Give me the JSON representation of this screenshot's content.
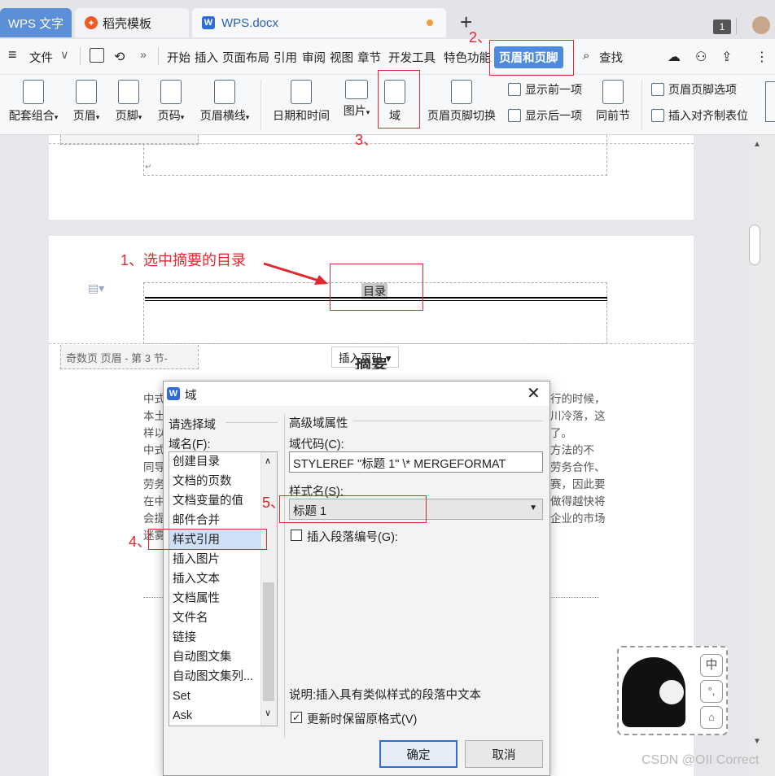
{
  "tabs": {
    "wps": "WPS 文字",
    "daoke": "稻壳模板",
    "doc": "WPS.docx",
    "plus": "+",
    "badge": "1"
  },
  "menu": {
    "file": "文件",
    "more": "»",
    "items": [
      "开始",
      "插入",
      "页面布局",
      "引用",
      "审阅",
      "视图",
      "章节",
      "开发工具",
      "特色功能"
    ],
    "active": "页眉和页脚",
    "search": "查找"
  },
  "ribbon": {
    "b1": "配套组合",
    "b2": "页眉",
    "b3": "页脚",
    "b4": "页码",
    "b5": "页眉横线",
    "b6": "日期和时间",
    "b7": "图片",
    "b8": "域",
    "b9": "页眉页脚切换",
    "prev": "显示前一项",
    "next": "显示后一项",
    "same": "同前节",
    "opts": "页眉页脚选项",
    "align": "插入对齐制表位"
  },
  "doc": {
    "toc": "目录",
    "header_label": "奇数页 页眉 - 第 3 节-",
    "insert_page_num": "插入页码",
    "heading": "摘要",
    "body_left": [
      "中式",
      "本土",
      "样以",
      "中式",
      "同导",
      "劳务",
      "在中",
      "会提",
      "迷雾"
    ],
    "body_right": [
      "行的时候，",
      "川冷落，这",
      "了。",
      "方法的不",
      "劳务合作、",
      "赛，因此要",
      "做得越快将",
      "企业的市场",
      ""
    ]
  },
  "annotations": {
    "a1": "1、选中摘要的目录",
    "a2": "2、",
    "a3": "3、",
    "a4": "4、",
    "a5": "5、"
  },
  "dialog": {
    "title": "域",
    "choose": "请选择域",
    "field_name": "域名(F):",
    "items": [
      "创建目录",
      "文档的页数",
      "文档变量的值",
      "邮件合并",
      "样式引用",
      "插入图片",
      "插入文本",
      "文档属性",
      "文件名",
      "链接",
      "自动图文集",
      "自动图文集列...",
      "Set",
      "Ask"
    ],
    "selected_index": 4,
    "advanced": "高级域属性",
    "code_label": "域代码(C):",
    "code_value": "STYLEREF \"标题 1\" \\* MERGEFORMAT",
    "style_label": "样式名(S):",
    "style_value": "标题 1",
    "para_num": "插入段落编号(G):",
    "desc": "说明:插入具有类似样式的段落中文本",
    "keep_format": "更新时保留原格式(V)",
    "ok": "确定",
    "cancel": "取消"
  },
  "ime": {
    "k1": "中",
    "k2": "°,",
    "k3": "👕"
  },
  "watermark": "CSDN @OII Correct"
}
